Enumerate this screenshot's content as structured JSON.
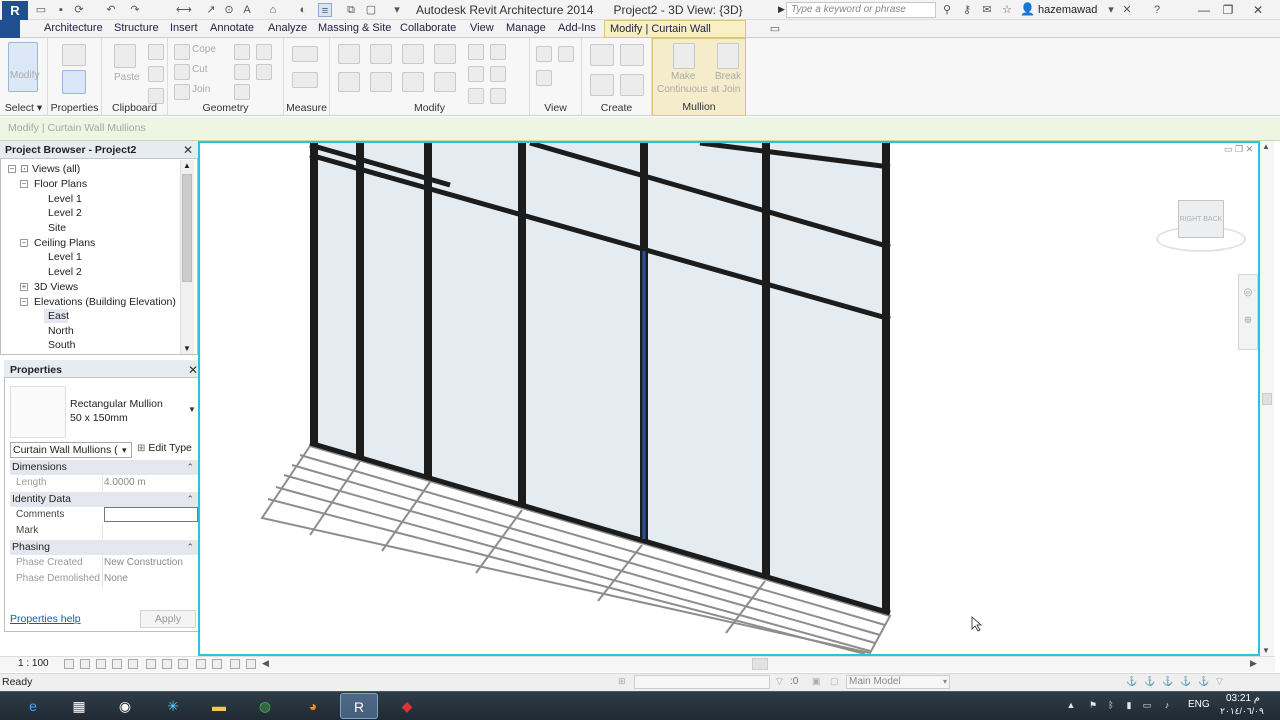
{
  "window": {
    "app_title": "Autodesk Revit Architecture 2014",
    "doc_title": "Project2 - 3D View: {3D}",
    "search_placeholder": "Type a keyword or phrase",
    "user": "hazemawad"
  },
  "ribbon_tabs": [
    "Architecture",
    "Structure",
    "Insert",
    "Annotate",
    "Analyze",
    "Massing & Site",
    "Collaborate",
    "View",
    "Manage",
    "Add-Ins"
  ],
  "active_tab": "Modify | Curtain Wall Mullions",
  "ribbon": {
    "modify_label": "Modify",
    "paste_label": "Paste",
    "cope_label": "Cope",
    "cut_label": "Cut",
    "join_label": "Join",
    "make_label": "Make",
    "continuous_label": "Continuous",
    "break_label": "Break",
    "at_join_label": "at Join",
    "panels": {
      "select": "Select",
      "properties": "Properties",
      "clipboard": "Clipboard",
      "geometry": "Geometry",
      "measure": "Measure",
      "modify": "Modify",
      "view": "View",
      "create": "Create",
      "mullion": "Mullion"
    }
  },
  "options_bar": "Modify | Curtain Wall Mullions",
  "project_browser": {
    "title": "Project Browser - Project2",
    "items": [
      {
        "label": "Views (all)",
        "toggle": "−"
      },
      {
        "label": "Floor Plans",
        "toggle": "−"
      },
      {
        "label": "Level 1"
      },
      {
        "label": "Level 2"
      },
      {
        "label": "Site"
      },
      {
        "label": "Ceiling Plans",
        "toggle": "−"
      },
      {
        "label": "Level 1"
      },
      {
        "label": "Level 2"
      },
      {
        "label": "3D Views",
        "toggle": "+"
      },
      {
        "label": "Elevations (Building Elevation)",
        "toggle": "−"
      },
      {
        "label": "East"
      },
      {
        "label": "North"
      },
      {
        "label": "South"
      }
    ]
  },
  "properties": {
    "title": "Properties",
    "type_name": "Rectangular Mullion",
    "type_size": "50 x 150mm",
    "instance_filter": "Curtain Wall Mullions (",
    "edit_type": "Edit Type",
    "groups": {
      "dimensions": "Dimensions",
      "identity": "Identity Data",
      "phasing": "Phasing"
    },
    "rows": {
      "length": {
        "name": "Length",
        "value": "4.0000 m"
      },
      "comments": {
        "name": "Comments",
        "value": ""
      },
      "mark": {
        "name": "Mark",
        "value": ""
      },
      "phase_created": {
        "name": "Phase Created",
        "value": "New Construction"
      },
      "phase_demolished": {
        "name": "Phase Demolished",
        "value": "None"
      }
    },
    "help": "Properties help",
    "apply": "Apply"
  },
  "viewcube": {
    "face_text": "RIGHT BACK"
  },
  "view_control": {
    "scale": "1 : 100"
  },
  "status": {
    "text": "Ready",
    "selection_count": ":0",
    "active_model": "Main Model"
  },
  "taskbar": {
    "language": "ENG",
    "time": "03:21 م",
    "date": "٢٠١٤/٠٦/٠٩"
  },
  "colors": {
    "viewport_border": "#26c5d8",
    "mullion_tab": "#f8f0c4",
    "options_bar": "#eef5e2",
    "selected_mullion": "#2a4f9b"
  }
}
